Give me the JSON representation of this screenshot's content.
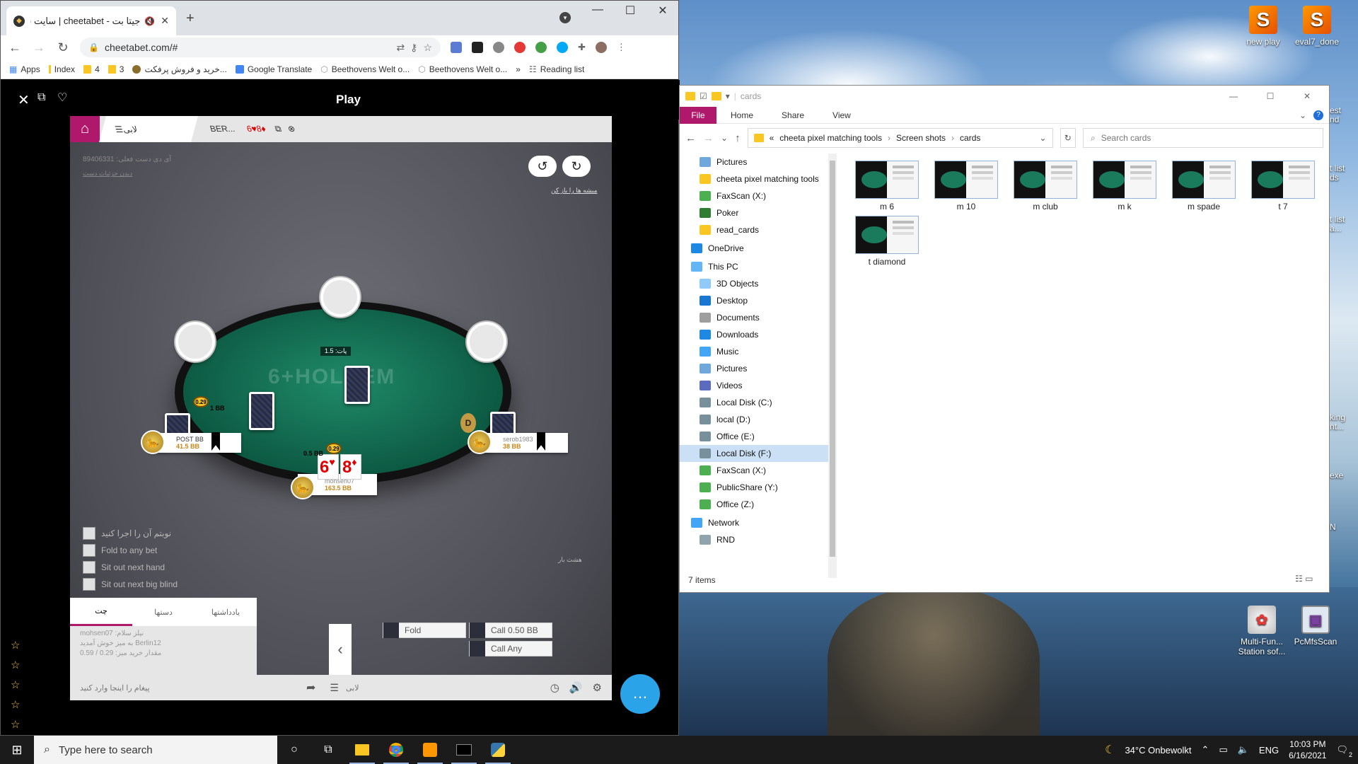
{
  "desktop": {
    "icons_top": [
      {
        "label": "new play"
      },
      {
        "label": "eval7_done"
      }
    ],
    "icons_bottom": [
      {
        "label": "Multi-Fun... Station sof..."
      },
      {
        "label": "PcMfsScan"
      }
    ],
    "edge_labels": [
      "est",
      "nd",
      "t list",
      "ds",
      "t list",
      "a...",
      "king",
      "nt...",
      "exe",
      "N"
    ]
  },
  "browser": {
    "tab_title": "جیتا بت - cheetabet | سایت ش",
    "url": "cheetabet.com/#",
    "bookmarks": [
      "Apps",
      "Index",
      "4",
      "3",
      "خرید و فروش پرفکت...",
      "Google Translate",
      "Beethovens Welt o...",
      "Beethovens Welt o...",
      "»",
      "Reading list"
    ]
  },
  "play": {
    "title": "Play",
    "top_tabs": {
      "lobby": "لابی",
      "table": "BER...",
      "hand": "6♥8♦"
    },
    "faint_id": "89406331 :آی دی دست فعلی",
    "faint_link": "دیدن جزئیات دست",
    "reload_text": "میشه ها را باز کن",
    "table_logo": "6+HOLDEM",
    "pot": "پات: 1.5",
    "players": [
      {
        "name": "POST BB",
        "stack": "41.5 BB",
        "bet": "0.29",
        "bet_bb": "1 BB"
      },
      {
        "name": "serob1983",
        "stack": "38 BB",
        "dealer": "D"
      },
      {
        "name": "mohsen07",
        "stack": "163.5 BB",
        "bet": "0.29",
        "bet_bb": "0.5 BB"
      }
    ],
    "hole_cards": [
      {
        "rank": "6",
        "suit": "♥"
      },
      {
        "rank": "8",
        "suit": "♦"
      }
    ],
    "options": [
      "نوبتم آن را اجرا کنید",
      "Fold to any bet",
      "Sit out next hand",
      "Sit out next big blind"
    ],
    "side_note": "هشت بار",
    "chat_tabs": [
      "چت",
      "دستها",
      "یادداشتها"
    ],
    "chat_lines": [
      "mohsen07 :نیلز سلام",
      "به میز خوش آمدید Berlin12",
      "مقدار خرید میز: 0.29 / 0.59"
    ],
    "actions": {
      "fold": "Fold",
      "call": "Call 0.50 BB",
      "call_any": "Call Any"
    },
    "chat_input_placeholder": "پیغام را اینجا وارد کنید",
    "bottom_lobby": "لابی"
  },
  "explorer": {
    "title": "cards",
    "ribbon": [
      "File",
      "Home",
      "Share",
      "View"
    ],
    "breadcrumb": [
      "«",
      "cheeta pixel matching tools",
      "Screen shots",
      "cards"
    ],
    "search_placeholder": "Search cards",
    "nav": [
      {
        "label": "Pictures",
        "color": "#6fa8dc",
        "indent": true
      },
      {
        "label": "cheeta pixel matching tools",
        "color": "#f9c623",
        "indent": true
      },
      {
        "label": "FaxScan (X:)",
        "color": "#4caf50",
        "indent": true
      },
      {
        "label": "Poker",
        "color": "#2e7d32",
        "indent": true
      },
      {
        "label": "read_cards",
        "color": "#f9c623",
        "indent": true
      },
      {
        "label": "OneDrive",
        "color": "#1e88e5",
        "indent": false
      },
      {
        "label": "This PC",
        "color": "#64b5f6",
        "indent": false
      },
      {
        "label": "3D Objects",
        "color": "#90caf9",
        "indent": true
      },
      {
        "label": "Desktop",
        "color": "#1976d2",
        "indent": true
      },
      {
        "label": "Documents",
        "color": "#9e9e9e",
        "indent": true
      },
      {
        "label": "Downloads",
        "color": "#1e88e5",
        "indent": true
      },
      {
        "label": "Music",
        "color": "#42a5f5",
        "indent": true
      },
      {
        "label": "Pictures",
        "color": "#6fa8dc",
        "indent": true
      },
      {
        "label": "Videos",
        "color": "#5c6bc0",
        "indent": true
      },
      {
        "label": "Local Disk (C:)",
        "color": "#78909c",
        "indent": true
      },
      {
        "label": "local (D:)",
        "color": "#78909c",
        "indent": true
      },
      {
        "label": "Office (E:)",
        "color": "#78909c",
        "indent": true
      },
      {
        "label": "Local Disk (F:)",
        "color": "#78909c",
        "indent": true
      },
      {
        "label": "FaxScan (X:)",
        "color": "#4caf50",
        "indent": true
      },
      {
        "label": "PublicShare (Y:)",
        "color": "#4caf50",
        "indent": true
      },
      {
        "label": "Office (Z:)",
        "color": "#4caf50",
        "indent": true
      },
      {
        "label": "Network",
        "color": "#42a5f5",
        "indent": false
      },
      {
        "label": "RND",
        "color": "#90a4ae",
        "indent": true
      }
    ],
    "files": [
      "m 6",
      "m 10",
      "m club",
      "m k",
      "m spade",
      "t 7",
      "t diamond"
    ],
    "status": "7 items"
  },
  "taskbar": {
    "search_placeholder": "Type here to search",
    "weather": "34°C  Onbewolkt",
    "lang": "ENG",
    "time": "10:03 PM",
    "date": "6/16/2021",
    "notifications": "2"
  }
}
